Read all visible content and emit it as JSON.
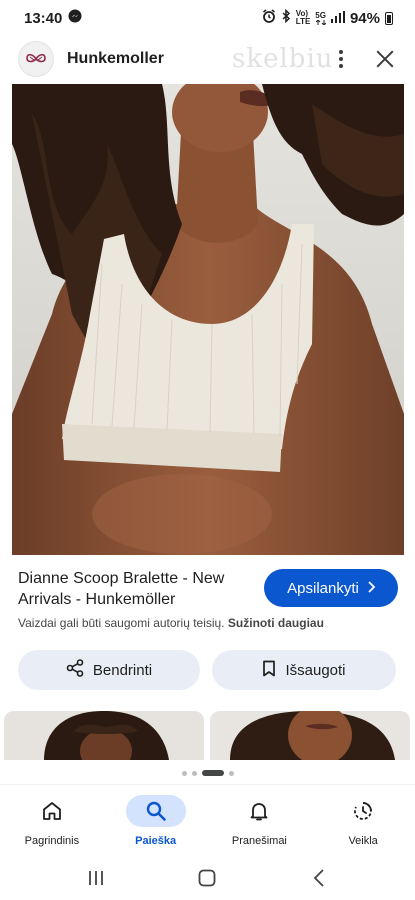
{
  "status_bar": {
    "time": "13:40",
    "network_top": "Vo)",
    "network_bottom": "LTE",
    "generation": "5G",
    "battery": "94%"
  },
  "header": {
    "site_name": "Hunkemoller",
    "watermark_text": "skelbiu"
  },
  "result": {
    "title": "Dianne Scoop Bralette - New Arrivals - Hunkemöller",
    "visit_label": "Apsilankyti",
    "copyright_notice": "Vaizdai gali būti saugomi autorių teisių.",
    "learn_more": "Sužinoti daugiau"
  },
  "actions": {
    "share_label": "Bendrinti",
    "save_label": "Išsaugoti"
  },
  "pager": {
    "count": 4,
    "active_index": 2
  },
  "bottom_nav": {
    "items": [
      {
        "label": "Pagrindinis",
        "icon": "home-icon",
        "active": false
      },
      {
        "label": "Paieška",
        "icon": "search-icon",
        "active": true
      },
      {
        "label": "Pranešimai",
        "icon": "bell-icon",
        "active": false
      },
      {
        "label": "Veikla",
        "icon": "activity-icon",
        "active": false
      }
    ]
  },
  "colors": {
    "accent": "#0b57d0",
    "chip_background": "#e9eef6",
    "active_nav_background": "#d3e3fd"
  }
}
